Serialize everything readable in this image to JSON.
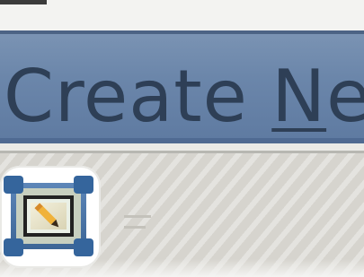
{
  "dialog": {
    "title_prefix": "Create ",
    "title_mnemonic": "N",
    "title_suffix": "ew"
  },
  "icons": {
    "new_item_icon": "edit-icon"
  },
  "colors": {
    "title_bar": "#6b86aa",
    "title_text": "#2e3f56",
    "content_bg": "#d6d4ce"
  }
}
